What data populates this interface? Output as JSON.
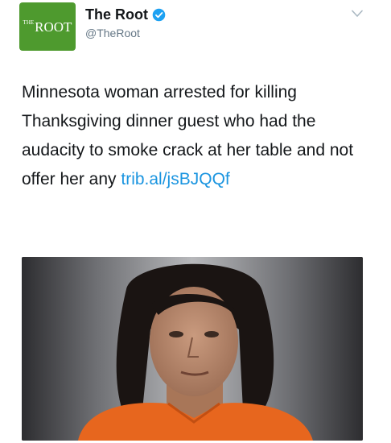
{
  "account": {
    "avatar_text_small": "THE",
    "avatar_text": "ROOT",
    "display_name": "The Root",
    "handle": "@TheRoot"
  },
  "tweet": {
    "text": "Minnesota woman arrested for killing Thanksgiving dinner guest who had the audacity to smoke crack at her table and not offer her any",
    "link_text": "trib.al/jsBJQQf"
  },
  "colors": {
    "brand_green": "#4e9a2e",
    "link_blue": "#1b95e0",
    "verified_blue": "#1da1f2"
  },
  "icons": {
    "verified": "verified-badge-icon",
    "menu": "chevron-down-icon"
  }
}
